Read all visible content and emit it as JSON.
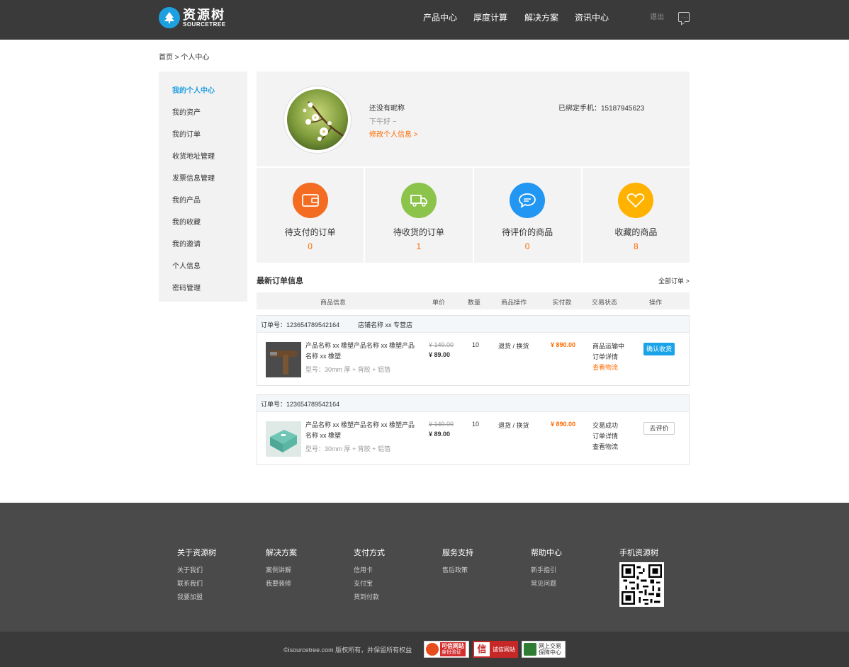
{
  "header": {
    "logo_cn": "资源树",
    "logo_en": "SOURCETREE",
    "nav": [
      "产品中心",
      "厚度计算",
      "解决方案",
      "资讯中心"
    ],
    "logout": "退出",
    "message_icon": "message-icon"
  },
  "breadcrumb": "首页 > 个人中心",
  "sidebar": {
    "items": [
      "我的个人中心",
      "我的资产",
      "我的订单",
      "收货地址管理",
      "发票信息管理",
      "我的产品",
      "我的收藏",
      "我的邀请",
      "个人信息",
      "密码管理"
    ]
  },
  "profile": {
    "nickname": "还没有昵称",
    "greeting": "下午好 ~",
    "edit_link": "修改个人信息 >",
    "phone": "已绑定手机：15187945623"
  },
  "stats": [
    {
      "label": "待支付的订单",
      "value": "0",
      "color": "#f36c21",
      "icon": "wallet-icon"
    },
    {
      "label": "待收货的订单",
      "value": "1",
      "color": "#8cc34b",
      "icon": "truck-icon"
    },
    {
      "label": "待评价的商品",
      "value": "0",
      "color": "#2196f3",
      "icon": "chat-icon"
    },
    {
      "label": "收藏的商品",
      "value": "8",
      "color": "#ffb300",
      "icon": "heart-icon"
    }
  ],
  "orders_section": {
    "title": "最新订单信息",
    "all_link": "全部订单 >",
    "columns": [
      "商品信息",
      "单价",
      "数量",
      "商品操作",
      "实付款",
      "交易状态",
      "操作"
    ]
  },
  "orders": [
    {
      "order_no": "订单号：123654789542164",
      "shop": "店铺名称 xx 专营店",
      "product_name": "产品名称 xx 橡塑产品名称 xx 橡塑产品名称 xx 橡塑",
      "spec": "型号：30mm 厚 + 背胶 + 铝箔",
      "old_price": "¥ 149.00",
      "price": "¥ 89.00",
      "qty": "10",
      "op": "退货 / 换货",
      "paid": "¥ 890.00",
      "status": [
        "商品运输中",
        "订单详情",
        "查看物流"
      ],
      "action": "确认收货"
    },
    {
      "order_no": "订单号：123654789542164",
      "shop": "",
      "product_name": "产品名称 xx 橡塑产品名称 xx 橡塑产品名称 xx 橡塑",
      "spec": "型号：30mm 厚 + 背胶 + 铝箔",
      "old_price": "¥ 149.00",
      "price": "¥ 89.00",
      "qty": "10",
      "op": "退货 / 换货",
      "paid": "¥ 890.00",
      "status": [
        "交易成功",
        "订单详情",
        "查看物流"
      ],
      "action": "去评价"
    }
  ],
  "footer": {
    "columns": [
      {
        "title": "关于资源树",
        "links": [
          "关于我们",
          "联系我们",
          "我要加盟"
        ]
      },
      {
        "title": "解决方案",
        "links": [
          "案例讲解",
          "我要装修"
        ]
      },
      {
        "title": "支付方式",
        "links": [
          "信用卡",
          "支付宝",
          "货到付款"
        ]
      },
      {
        "title": "服务支持",
        "links": [
          "售后政策"
        ]
      },
      {
        "title": "帮助中心",
        "links": [
          "新手指引",
          "常见问题"
        ]
      },
      {
        "title": "手机资源树",
        "links": []
      }
    ],
    "copyright": "©isourcetree.com 版权所有，并保留所有权益",
    "badges": [
      {
        "main": "可信网站",
        "sub": "身份验证"
      },
      {
        "main": "诚信网站",
        "sub": ""
      },
      {
        "main": "网上交易",
        "sub": "保障中心"
      }
    ]
  }
}
